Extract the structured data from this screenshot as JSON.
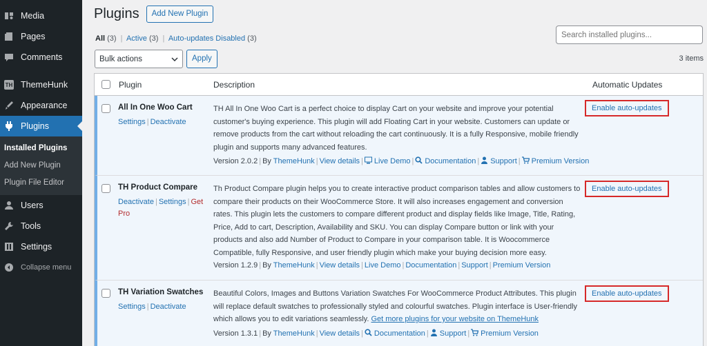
{
  "sidebar": {
    "items": [
      {
        "label": "Media",
        "icon": "media-icon"
      },
      {
        "label": "Pages",
        "icon": "pages-icon"
      },
      {
        "label": "Comments",
        "icon": "comments-icon"
      },
      {
        "label": "ThemeHunk",
        "icon": "themehunk-icon"
      },
      {
        "label": "Appearance",
        "icon": "appearance-icon"
      },
      {
        "label": "Plugins",
        "icon": "plugins-icon"
      },
      {
        "label": "Users",
        "icon": "users-icon"
      },
      {
        "label": "Tools",
        "icon": "tools-icon"
      },
      {
        "label": "Settings",
        "icon": "settings-icon"
      },
      {
        "label": "Collapse menu",
        "icon": "collapse-icon"
      }
    ],
    "themehunk_badge": "TH",
    "submenu": [
      "Installed Plugins",
      "Add New Plugin",
      "Plugin File Editor"
    ]
  },
  "header": {
    "title": "Plugins",
    "add_new": "Add New Plugin",
    "search_placeholder": "Search installed plugins..."
  },
  "filters": {
    "all": "All",
    "all_count": "(3)",
    "active": "Active",
    "active_count": "(3)",
    "autodisabled": "Auto-updates Disabled",
    "autodisabled_count": "(3)",
    "sep": "|"
  },
  "bulk": {
    "selected": "Bulk actions",
    "apply": "Apply"
  },
  "items_count": "3 items",
  "table": {
    "headers": {
      "plugin": "Plugin",
      "description": "Description",
      "auto": "Automatic Updates"
    },
    "enable_label": "Enable auto-updates"
  },
  "plugins": [
    {
      "name": "All In One Woo Cart",
      "actions": [
        "Settings",
        "Deactivate"
      ],
      "description": "TH All In One Woo Cart is a perfect choice to display Cart on your website and improve your potential customer's buying experience. This plugin will add Floating Cart in your website. Customers can update or remove products from the cart without reloading the cart continuously. It is a fully Responsive, mobile friendly plugin and supports many advanced features.",
      "version": "Version 2.0.2",
      "by": "By",
      "author": "ThemeHunk",
      "links": [
        "View details",
        "Live Demo",
        "Documentation",
        "Support",
        "Premium Version"
      ]
    },
    {
      "name": "TH Product Compare",
      "actions": [
        "Deactivate",
        "Settings",
        "Get Pro"
      ],
      "description": "Th Product Compare plugin helps you to create interactive product comparison tables and allow customers to compare their products on their WooCommerce Store. It will also increases engagement and conversion rates. This plugin lets the customers to compare different product and display fields like Image, Title, Rating, Price, Add to cart, Description, Availability and SKU. You can display Compare button or link with your products and also add Number of Product to Compare in your comparison table. It is Woocommerce Compatible, fully Responsive, and user friendly plugin which make your buying decision more easy.",
      "version": "Version 1.2.9",
      "by": "By",
      "author": "ThemeHunk",
      "links": [
        "View details",
        "Live Demo",
        "Documentation",
        "Support",
        "Premium Version"
      ]
    },
    {
      "name": "TH Variation Swatches",
      "actions": [
        "Settings",
        "Deactivate"
      ],
      "description": "Beautiful Colors, Images and Buttons Variation Swatches For WooCommerce Product Attributes. This plugin will replace default swatches to professionally styled and colourful swatches. Plugin interface is User-friendly which allows you to edit variations seamlessly.",
      "description_link": "Get more plugins for your website on ThemeHunk",
      "version": "Version 1.3.1",
      "by": "By",
      "author": "ThemeHunk",
      "links": [
        "View details",
        "Documentation",
        "Support",
        "Premium Version"
      ]
    }
  ]
}
